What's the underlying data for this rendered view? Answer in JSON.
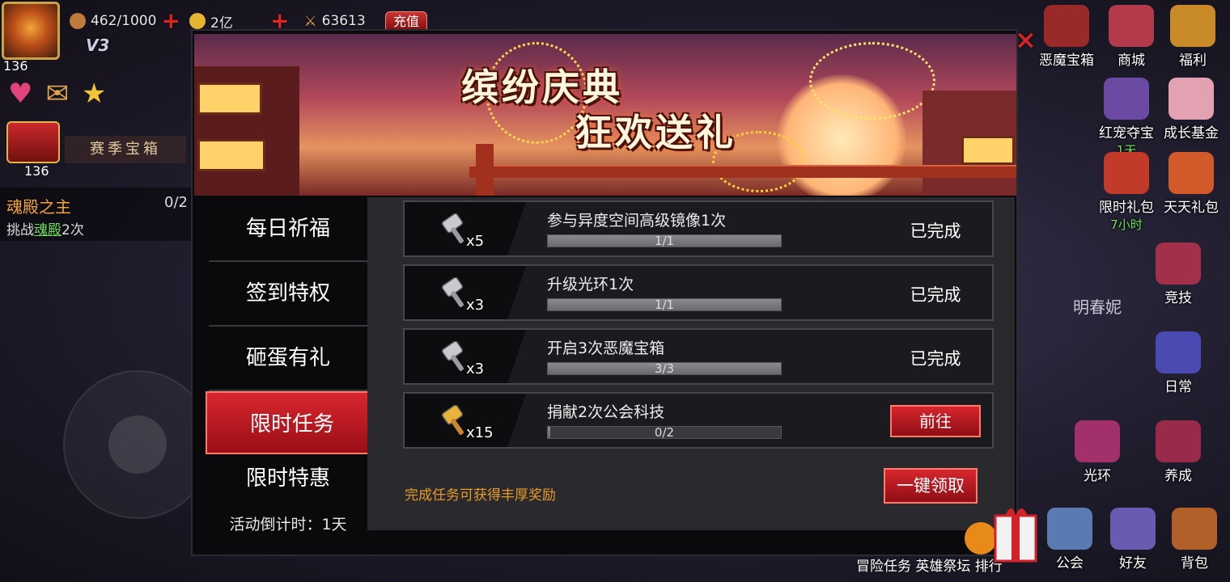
{
  "hud": {
    "player_level": "136",
    "vip": "V3",
    "stamina": "462/1000",
    "gold": "2亿",
    "power": "63613",
    "charge_label": "充值",
    "season_chest_label": "赛季宝箱",
    "season_count": "136"
  },
  "quest": {
    "title": "魂殿之主",
    "progress": "0/2",
    "desc_prefix": "挑战",
    "desc_highlight": "魂殿",
    "desc_suffix": "2次"
  },
  "right_menu": [
    {
      "label": "恶魔宝箱",
      "sub": ""
    },
    {
      "label": "商城",
      "sub": ""
    },
    {
      "label": "福利",
      "sub": ""
    },
    {
      "label": "红宠夺宝",
      "sub": "1天"
    },
    {
      "label": "成长基金",
      "sub": ""
    },
    {
      "label": "限时礼包",
      "sub": "7小时"
    },
    {
      "label": "天天礼包",
      "sub": ""
    },
    {
      "label": "竞技",
      "sub": ""
    },
    {
      "label": "日常",
      "sub": ""
    },
    {
      "label": "养成",
      "sub": ""
    },
    {
      "label": "光环",
      "sub": ""
    },
    {
      "label": "公会",
      "sub": ""
    },
    {
      "label": "好友",
      "sub": ""
    },
    {
      "label": "背包",
      "sub": ""
    }
  ],
  "npc_name": "明春妮",
  "bottom_bar_text": "冒险任务 英雄祭坛 排行",
  "modal": {
    "banner_line1": "缤纷庆典",
    "banner_line2": "狂欢送礼",
    "close_icon": "×",
    "sidebar": [
      {
        "label": "每日祈福",
        "active": false
      },
      {
        "label": "签到特权",
        "active": false
      },
      {
        "label": "砸蛋有礼",
        "active": false
      },
      {
        "label": "限时任务",
        "active": true
      },
      {
        "label": "限时特惠",
        "active": false
      }
    ],
    "countdown": "活动倒计时：1天",
    "tasks": [
      {
        "reward_icon": "silver-hammer-icon",
        "reward_count": "x5",
        "name": "参与异度空间高级镜像1次",
        "progress_text": "1/1",
        "progress": 1,
        "status": "已完成"
      },
      {
        "reward_icon": "silver-hammer-icon",
        "reward_count": "x3",
        "name": "升级光环1次",
        "progress_text": "1/1",
        "progress": 1,
        "status": "已完成"
      },
      {
        "reward_icon": "silver-hammer-icon",
        "reward_count": "x3",
        "name": "开启3次恶魔宝箱",
        "progress_text": "3/3",
        "progress": 1,
        "status": "已完成"
      },
      {
        "reward_icon": "gold-hammer-icon",
        "reward_count": "x15",
        "name": "捐献2次公会科技",
        "progress_text": "0/2",
        "progress": 0,
        "status": "",
        "button": "前往"
      }
    ],
    "footer_tip": "完成任务可获得丰厚奖励",
    "claim_all": "一键领取"
  }
}
